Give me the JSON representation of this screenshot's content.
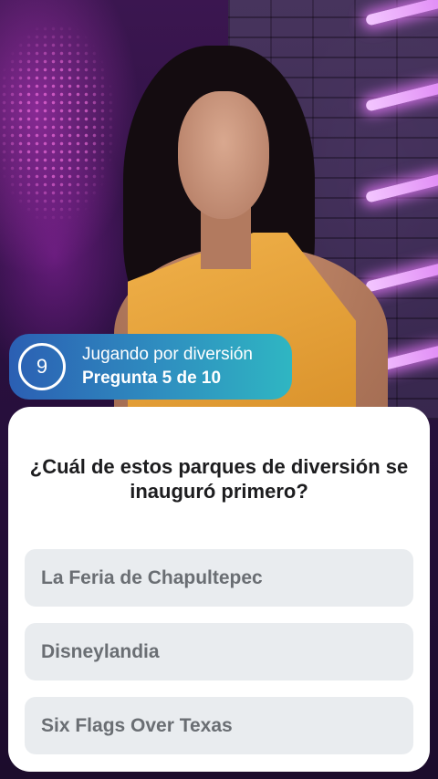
{
  "status": {
    "timer_value": "9",
    "mode_label": "Jugando por diversión",
    "progress_label": "Pregunta 5 de 10"
  },
  "question": {
    "text": "¿Cuál de estos parques de diversión se inauguró primero?"
  },
  "answers": [
    {
      "label": "La Feria de Chapultepec"
    },
    {
      "label": "Disneylandia"
    },
    {
      "label": "Six Flags Over Texas"
    }
  ],
  "colors": {
    "pill_gradient_start": "#2b5fb3",
    "pill_gradient_end": "#2fb6c2",
    "answer_bg": "#e9ecef",
    "answer_text": "#6a6e73"
  }
}
